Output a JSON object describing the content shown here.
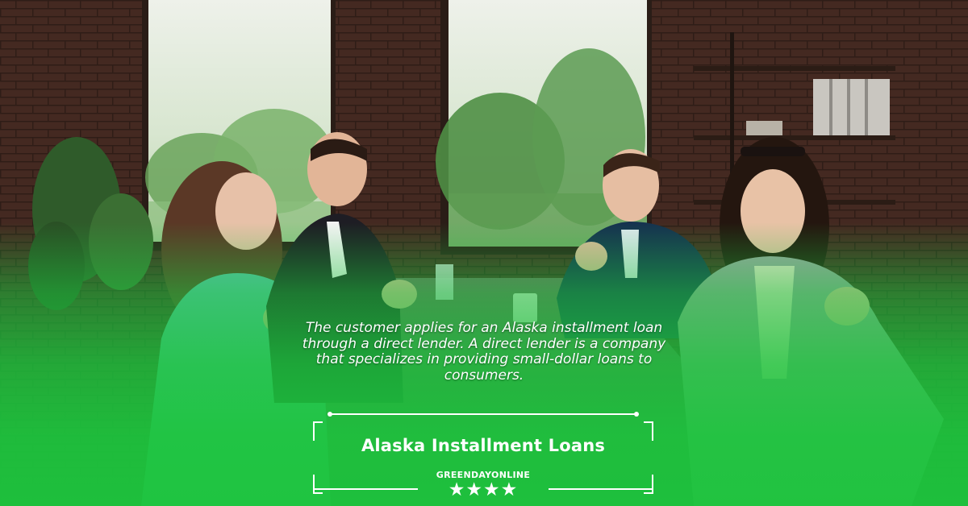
{
  "caption": "The customer applies for an Alaska installment loan through a direct lender. A direct lender is a company that specializes in providing small-dollar loans to consumers.",
  "title": "Alaska Installment Loans",
  "brand": "GREENDAYONLINE",
  "stars": "★★★★",
  "rating": 4,
  "colors": {
    "overlay_green": "#1dc43d",
    "text": "#ffffff",
    "brick": "#4a2f25"
  }
}
